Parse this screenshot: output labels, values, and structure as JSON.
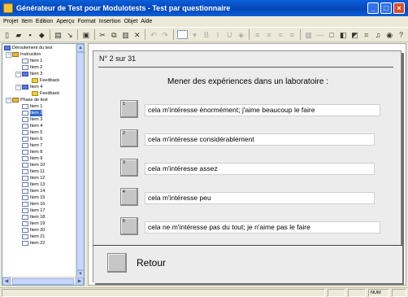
{
  "window": {
    "title": "Générateur de Test pour Modulotests - Test par questionnaire",
    "minimize": "_",
    "maximize": "□",
    "close": "×"
  },
  "menu": [
    "Projet",
    "Item",
    "Edition",
    "Aperçu",
    "Format",
    "Insertion",
    "Objet",
    "Aide"
  ],
  "toolbar": {
    "bold": "B",
    "italic": "I",
    "underline": "U",
    "help": "?"
  },
  "tree": {
    "root": "Déroulement du test",
    "instruction": "Instruction",
    "phase": "Phase de test",
    "instruction_items": [
      "Item 1",
      "Item 2",
      "Item 3"
    ],
    "feedback1": "Feedback",
    "item4": "Item 4",
    "feedback2": "Feedback",
    "phase_items": [
      "Item 1",
      "Item 2",
      "Item 3",
      "Item 4",
      "Item 5",
      "Item 6",
      "Item 7",
      "Item 8",
      "Item 9",
      "Item 10",
      "Item 11",
      "Item 12",
      "Item 13",
      "Item 14",
      "Item 15",
      "Item 16",
      "Item 17",
      "Item 18",
      "Item 19",
      "Item 20",
      "Item 21",
      "Item 22"
    ],
    "selected_index": 1
  },
  "slide": {
    "counter": "N° 2 sur 31",
    "question": "Mener des expériences dans un laboratoire :",
    "answers": [
      {
        "num": "1",
        "text": "cela m'intéresse énormément; j'aime beaucoup le faire"
      },
      {
        "num": "2",
        "text": "cela m'intéresse considérablement"
      },
      {
        "num": "3",
        "text": "cela m'intéresse assez"
      },
      {
        "num": "4",
        "text": "cela m'intéresse peu"
      },
      {
        "num": "5",
        "text": "cela ne m'intéresse pas du tout; je n'aime pas le faire"
      }
    ],
    "back": "Retour"
  },
  "status": {
    "num": "NUM"
  }
}
